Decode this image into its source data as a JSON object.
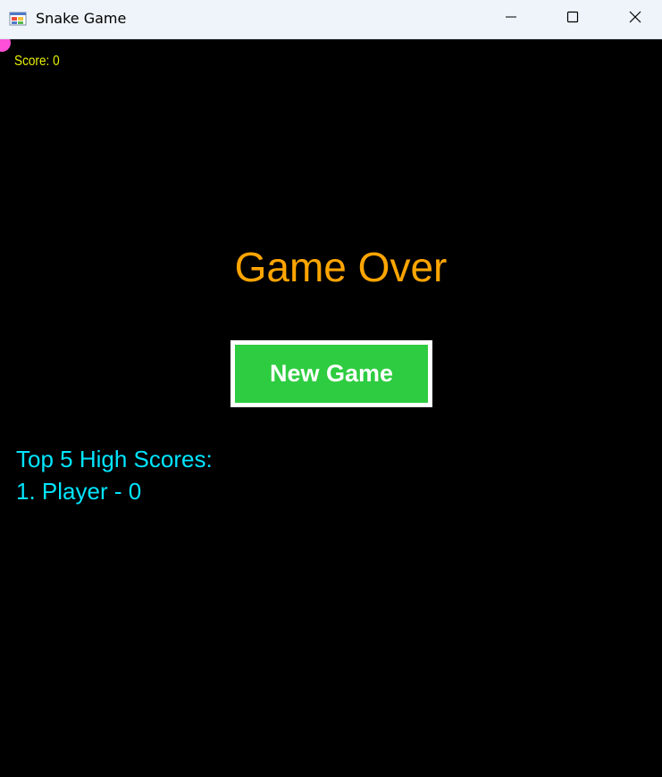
{
  "window": {
    "title": "Snake Game",
    "icon": "windows-forms-app-icon",
    "controls": [
      "minimize-icon",
      "maximize-icon",
      "close-icon"
    ]
  },
  "game": {
    "score_text": "Score: 0",
    "game_over_text": "Game Over",
    "new_game_label": "New Game",
    "high_scores_title": "Top 5 High Scores:",
    "high_scores": [
      "1. Player - 0"
    ]
  },
  "colors": {
    "background": "#000000",
    "titlebar": "#eef4f9",
    "score": "#e7f000",
    "game_over": "#ffa500",
    "button": "#2ecc40",
    "button_border": "#ffffff",
    "high_scores": "#00e5ff",
    "food": "#ff4fd8"
  }
}
